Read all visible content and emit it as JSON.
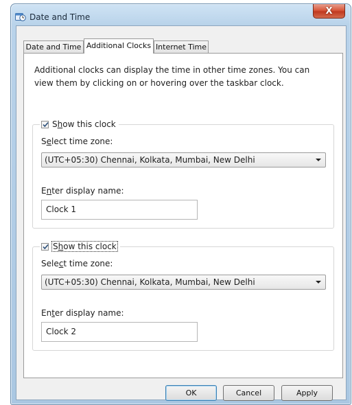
{
  "window": {
    "title": "Date and Time",
    "close_label": "X"
  },
  "tabs": [
    {
      "label": "Date and Time",
      "active": false
    },
    {
      "label": "Additional Clocks",
      "active": true
    },
    {
      "label": "Internet Time",
      "active": false
    }
  ],
  "intro_text": "Additional clocks can display the time in other time zones. You can view them by clicking on or hovering over the taskbar clock.",
  "clocks": [
    {
      "show_label_pre": "S",
      "show_label_u": "h",
      "show_label_post": "ow this clock",
      "checked": true,
      "tz_label_pre": "S",
      "tz_label_u": "e",
      "tz_label_post": "lect time zone:",
      "timezone": "(UTC+05:30) Chennai, Kolkata, Mumbai, New Delhi",
      "name_label_pre": "E",
      "name_label_u": "n",
      "name_label_post": "ter display name:",
      "display_name": "Clock 1"
    },
    {
      "show_label_pre": "S",
      "show_label_u": "h",
      "show_label_post": "ow this clock",
      "checked": true,
      "tz_label_pre": "Sele",
      "tz_label_u": "c",
      "tz_label_post": "t time zone:",
      "timezone": "(UTC+05:30) Chennai, Kolkata, Mumbai, New Delhi",
      "name_label_pre": "En",
      "name_label_u": "t",
      "name_label_post": "er display name:",
      "display_name": "Clock 2"
    }
  ],
  "buttons": {
    "ok": "OK",
    "cancel": "Cancel",
    "apply": "Apply"
  }
}
